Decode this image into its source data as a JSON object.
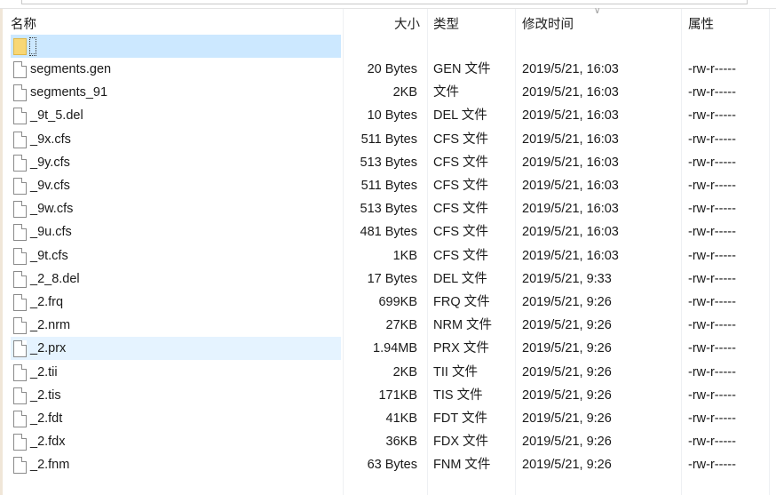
{
  "columns": {
    "name": "名称",
    "size": "大小",
    "type": "类型",
    "modified": "修改时间",
    "attributes": "属性"
  },
  "parent_dir": "..",
  "files": [
    {
      "name": "segments.gen",
      "size": "20 Bytes",
      "type": "GEN 文件",
      "modified": "2019/5/21, 16:03",
      "attr": "-rw-r-----"
    },
    {
      "name": "segments_91",
      "size": "2KB",
      "type": "文件",
      "modified": "2019/5/21, 16:03",
      "attr": "-rw-r-----"
    },
    {
      "name": "_9t_5.del",
      "size": "10 Bytes",
      "type": "DEL 文件",
      "modified": "2019/5/21, 16:03",
      "attr": "-rw-r-----"
    },
    {
      "name": "_9x.cfs",
      "size": "511 Bytes",
      "type": "CFS 文件",
      "modified": "2019/5/21, 16:03",
      "attr": "-rw-r-----"
    },
    {
      "name": "_9y.cfs",
      "size": "513 Bytes",
      "type": "CFS 文件",
      "modified": "2019/5/21, 16:03",
      "attr": "-rw-r-----"
    },
    {
      "name": "_9v.cfs",
      "size": "511 Bytes",
      "type": "CFS 文件",
      "modified": "2019/5/21, 16:03",
      "attr": "-rw-r-----"
    },
    {
      "name": "_9w.cfs",
      "size": "513 Bytes",
      "type": "CFS 文件",
      "modified": "2019/5/21, 16:03",
      "attr": "-rw-r-----"
    },
    {
      "name": "_9u.cfs",
      "size": "481 Bytes",
      "type": "CFS 文件",
      "modified": "2019/5/21, 16:03",
      "attr": "-rw-r-----"
    },
    {
      "name": "_9t.cfs",
      "size": "1KB",
      "type": "CFS 文件",
      "modified": "2019/5/21, 16:03",
      "attr": "-rw-r-----"
    },
    {
      "name": "_2_8.del",
      "size": "17 Bytes",
      "type": "DEL 文件",
      "modified": "2019/5/21, 9:33",
      "attr": "-rw-r-----"
    },
    {
      "name": "_2.frq",
      "size": "699KB",
      "type": "FRQ 文件",
      "modified": "2019/5/21, 9:26",
      "attr": "-rw-r-----"
    },
    {
      "name": "_2.nrm",
      "size": "27KB",
      "type": "NRM 文件",
      "modified": "2019/5/21, 9:26",
      "attr": "-rw-r-----"
    },
    {
      "name": "_2.prx",
      "size": "1.94MB",
      "type": "PRX 文件",
      "modified": "2019/5/21, 9:26",
      "attr": "-rw-r-----"
    },
    {
      "name": "_2.tii",
      "size": "2KB",
      "type": "TII 文件",
      "modified": "2019/5/21, 9:26",
      "attr": "-rw-r-----"
    },
    {
      "name": "_2.tis",
      "size": "171KB",
      "type": "TIS 文件",
      "modified": "2019/5/21, 9:26",
      "attr": "-rw-r-----"
    },
    {
      "name": "_2.fdt",
      "size": "41KB",
      "type": "FDT 文件",
      "modified": "2019/5/21, 9:26",
      "attr": "-rw-r-----"
    },
    {
      "name": "_2.fdx",
      "size": "36KB",
      "type": "FDX 文件",
      "modified": "2019/5/21, 9:26",
      "attr": "-rw-r-----"
    },
    {
      "name": "_2.fnm",
      "size": "63 Bytes",
      "type": "FNM 文件",
      "modified": "2019/5/21, 9:26",
      "attr": "-rw-r-----"
    }
  ],
  "hovered_index": 12
}
